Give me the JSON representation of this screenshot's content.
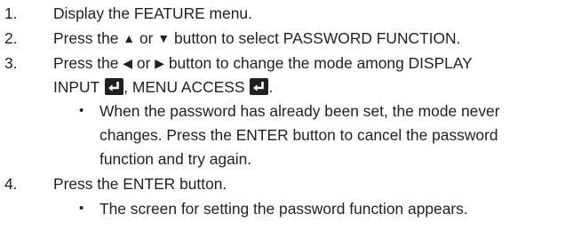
{
  "steps": [
    {
      "number": "1.",
      "lines": [
        "Display the FEATURE menu."
      ]
    },
    {
      "number": "2.",
      "text_a": "Press the ",
      "up_glyph": "▲",
      "text_b": " or ",
      "down_glyph": "▼",
      "text_c": " button to select PASSWORD FUNCTION."
    },
    {
      "number": "3.",
      "text_a": "Press the ",
      "left_glyph": "◀",
      "text_b": " or ",
      "right_glyph": "▶",
      "text_c": " button to change the mode among DISPLAY",
      "line2_a": "INPUT",
      "line2_b": ", MENU ACCESS",
      "line2_c": ".",
      "bullet": "•",
      "note_lines": [
        "When the password has already been set, the mode never",
        "changes. Press the ENTER button to cancel the password",
        "function and try again."
      ]
    },
    {
      "number": "4.",
      "lines": [
        "Press the ENTER button."
      ],
      "bullet": "•",
      "note_lines": [
        "The screen for setting the password function appears."
      ]
    }
  ],
  "icons": {
    "enter_icon_name": "enter-key-icon"
  }
}
